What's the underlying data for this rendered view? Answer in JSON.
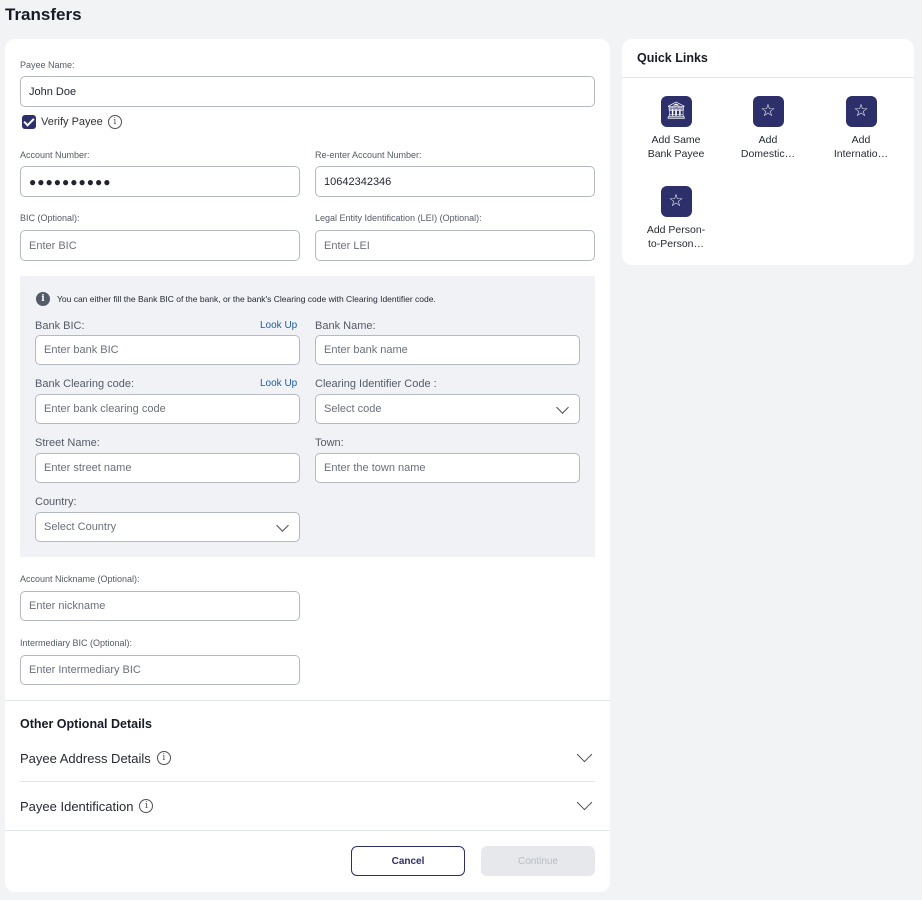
{
  "page": {
    "title": "Transfers"
  },
  "form": {
    "payee_name": {
      "label": "Payee Name:",
      "value": "John Doe"
    },
    "verify_payee": {
      "label": "Verify Payee",
      "checked": true
    },
    "account_number": {
      "label": "Account Number:",
      "value": "●●●●●●●●●●"
    },
    "reenter_account_number": {
      "label": "Re-enter Account Number:",
      "value": "10642342346"
    },
    "bic": {
      "label": "BIC (Optional):",
      "placeholder": "Enter BIC"
    },
    "lei": {
      "label": "Legal Entity Identification (LEI) (Optional):",
      "placeholder": "Enter LEI"
    },
    "bank_panel": {
      "note": "You can either fill the Bank BIC of the bank, or the bank's Clearing code with Clearing Identifier code.",
      "bank_bic": {
        "label": "Bank BIC:",
        "lookup": "Look Up",
        "placeholder": "Enter bank BIC"
      },
      "bank_name": {
        "label": "Bank Name:",
        "placeholder": "Enter bank name"
      },
      "clearing_code": {
        "label": "Bank Clearing code:",
        "lookup": "Look Up",
        "placeholder": "Enter bank clearing code"
      },
      "clearing_identifier": {
        "label": "Clearing Identifier Code :",
        "placeholder": "Select code"
      },
      "street": {
        "label": "Street Name:",
        "placeholder": "Enter street name"
      },
      "town": {
        "label": "Town:",
        "placeholder": "Enter the town name"
      },
      "country": {
        "label": "Country:",
        "placeholder": "Select Country"
      }
    },
    "nickname": {
      "label": "Account Nickname (Optional):",
      "placeholder": "Enter nickname"
    },
    "intermediary_bic": {
      "label": "Intermediary BIC (Optional):",
      "placeholder": "Enter Intermediary BIC"
    }
  },
  "optional": {
    "title": "Other Optional Details",
    "address": "Payee Address Details",
    "identification": "Payee Identification"
  },
  "buttons": {
    "cancel": "Cancel",
    "continue": "Continue"
  },
  "quick_links": {
    "title": "Quick Links",
    "items": [
      {
        "line1": "Add Same",
        "line2": "Bank Payee",
        "icon": "bank-icon"
      },
      {
        "line1": "Add",
        "line2": "Domestic…",
        "icon": "star-icon"
      },
      {
        "line1": "Add",
        "line2": "Internatio…",
        "icon": "star-icon"
      },
      {
        "line1": "Add Person-",
        "line2": "to-Person…",
        "icon": "star-icon"
      }
    ]
  },
  "colors": {
    "accent": "#2d2f6b",
    "link": "#1f5fa8",
    "panel": "#f0f2f5"
  }
}
